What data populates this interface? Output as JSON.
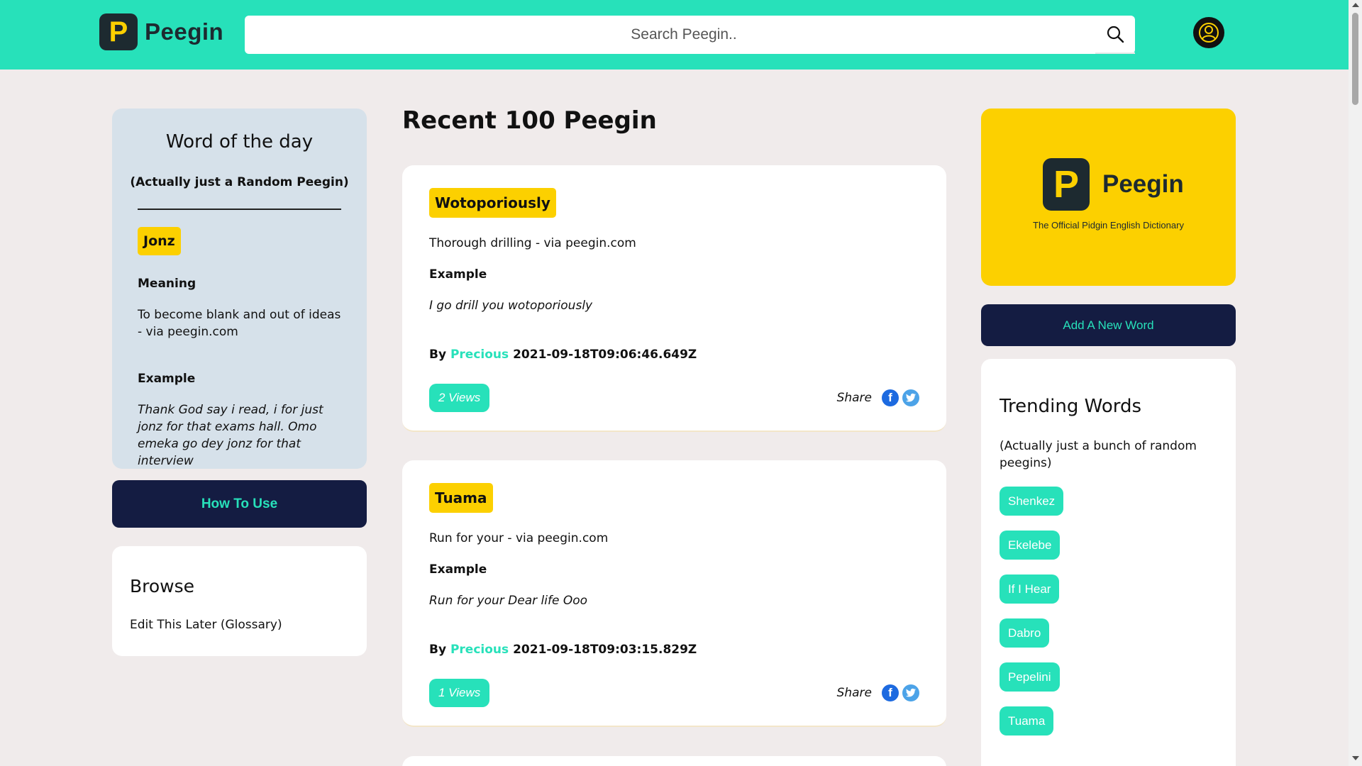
{
  "header": {
    "brand_letter": "P",
    "brand_name": "Peegin",
    "search_placeholder": "Search Peegin.."
  },
  "word_of_day": {
    "title": "Word of the day",
    "subtitle": "(Actually just a Random Peegin)",
    "word": "Jonz",
    "meaning_label": "Meaning",
    "meaning": "To become blank and out of ideas - via peegin.com",
    "example_label": "Example",
    "example": "Thank God say i read, i for just jonz for that exams hall. Omo emeka go dey jonz for that interview"
  },
  "how_to_use_label": "How To Use",
  "browse": {
    "title": "Browse",
    "link": "Edit This Later (Glossary)"
  },
  "feed": {
    "title": "Recent 100 Peegin",
    "by_label": "By",
    "example_label": "Example",
    "share_label": "Share",
    "cards": [
      {
        "word": "Wotoporiously",
        "meaning": "Thorough drilling - via peegin.com",
        "example": "I go drill you wotoporiously",
        "author": "Precious",
        "timestamp": "2021-09-18T09:06:46.649Z",
        "views": "2 Views"
      },
      {
        "word": "Tuama",
        "meaning": "Run for your - via peegin.com",
        "example": "Run for your Dear life Ooo",
        "author": "Precious",
        "timestamp": "2021-09-18T09:03:15.829Z",
        "views": "1 Views"
      }
    ]
  },
  "ad": {
    "brand_letter": "P",
    "brand_name": "Peegin",
    "tagline": "The Official Pidgin English Dictionary"
  },
  "add_word_label": "Add A New Word",
  "trending": {
    "title": "Trending Words",
    "subtitle": "(Actually just a bunch of random peegins)",
    "words": [
      "Shenkez",
      "Ekelebe",
      "If I Hear",
      "Dabro",
      "Pepelini",
      "Tuama"
    ]
  },
  "colors": {
    "brand_teal": "#27e1ba",
    "brand_yellow": "#fcd000",
    "navy": "#141c42",
    "page_bg": "#f0ebeb",
    "wotd_bg": "#d6e1ea"
  }
}
